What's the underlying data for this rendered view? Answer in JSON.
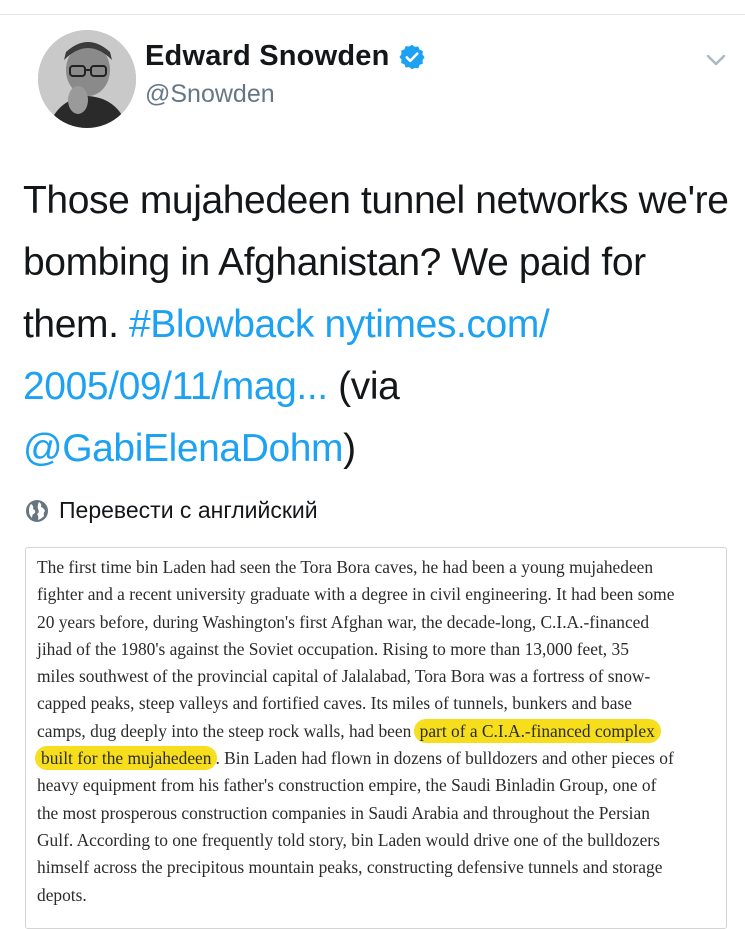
{
  "author": {
    "display_name": "Edward Snowden",
    "handle": "@Snowden",
    "verified_icon": "verified-badge-icon",
    "avatar_icon": "profile-photo"
  },
  "tweet": {
    "text_part1": "Those mujahedeen tunnel networks we're bombing in Afghanistan? We paid for them.",
    "hashtag": "#Blowback",
    "link_line1": "nytimes.com/",
    "link_line2": "2005/09/11/mag...",
    "via_prefix": "(via",
    "mention": "@GabiElenaDohm",
    "close_paren": ")"
  },
  "translate": {
    "label": "Перевести с английский",
    "icon": "globe-icon"
  },
  "article": {
    "lines": [
      "The first time bin Laden had seen the Tora Bora caves, he had been a young mujahedeen",
      "fighter and a recent university graduate with a degree in civil engineering. It had been some",
      "20 years before, during Washington's first Afghan war, the decade-long, C.I.A.-financed",
      "jihad of the 1980's against the Soviet occupation. Rising to more than 13,000 feet, 35",
      "miles southwest of the provincial capital of Jalalabad, Tora Bora was a fortress of snow-",
      "capped peaks, steep valleys and fortified caves. Its miles of tunnels, bunkers and base",
      "camps, dug deeply into the steep rock walls, had been",
      "heavy equipment from his father's construction empire, the Saudi Binladin Group, one of",
      "the most prosperous construction companies in Saudi Arabia and throughout the Persian",
      "Gulf. According to one frequently told story, bin Laden would drive one of the bulldozers",
      "himself across the precipitous mountain peaks, constructing defensive tunnels and storage",
      "depots."
    ],
    "highlight1": "part of a C.I.A.-financed complex",
    "highlight2": "built for the mujahedeen",
    "after_highlight": ". Bin Laden had flown in dozens of bulldozers and other pieces of",
    "highlight_color": "#f7de1c"
  },
  "colors": {
    "link": "#1da1f2",
    "secondary": "#657786",
    "text": "#14171a"
  }
}
